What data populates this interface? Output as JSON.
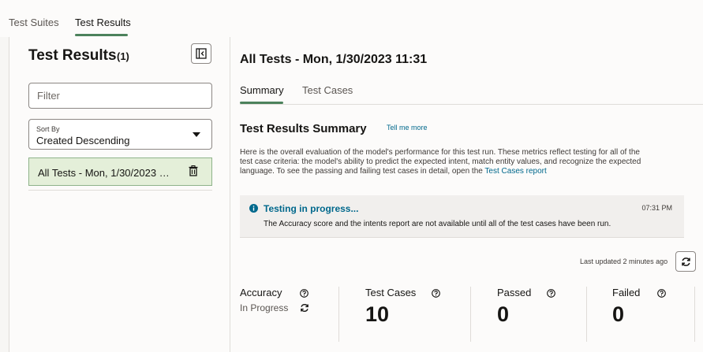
{
  "top_tabs": [
    {
      "label": "Test Suites",
      "active": false
    },
    {
      "label": "Test Results",
      "active": true
    }
  ],
  "left_pane": {
    "title": "Test Results",
    "count": "(1)",
    "filter_placeholder": "Filter",
    "sort": {
      "label": "Sort By",
      "value": "Created Descending"
    },
    "runs": [
      {
        "label": "All Tests - Mon, 1/30/2023 11:31",
        "selected": true
      }
    ]
  },
  "main": {
    "title": "All Tests - Mon, 1/30/2023 11:31",
    "tabs": [
      {
        "label": "Summary",
        "active": true
      },
      {
        "label": "Test Cases",
        "active": false
      }
    ],
    "summary": {
      "title": "Test Results Summary",
      "tell_me_more": "Tell me more",
      "description": "Here is the overall evaluation of the model's performance for this test run. These metrics reflect testing for all of the test case criteria: the model's ability to predict the expected intent, match entity values, and recognize the expected language. To see the passing and failing test cases in detail, open the",
      "description_link": "Test Cases report"
    },
    "banner": {
      "icon": "info-icon",
      "title": "Testing in progress...",
      "time": "07:31 PM",
      "text": "The Accuracy score and the intents report are not available until all of the test cases have been run."
    },
    "last_updated": "Last updated 2 minutes ago",
    "metrics": {
      "accuracy": {
        "label": "Accuracy",
        "status": "In Progress"
      },
      "test_cases": {
        "label": "Test Cases",
        "value": "10"
      },
      "passed": {
        "label": "Passed",
        "value": "0"
      },
      "failed": {
        "label": "Failed",
        "value": "0"
      }
    }
  },
  "colors": {
    "accent_green": "#4c825c",
    "link_blue": "#00688c",
    "selected_row_bg": "#e4efd9"
  }
}
